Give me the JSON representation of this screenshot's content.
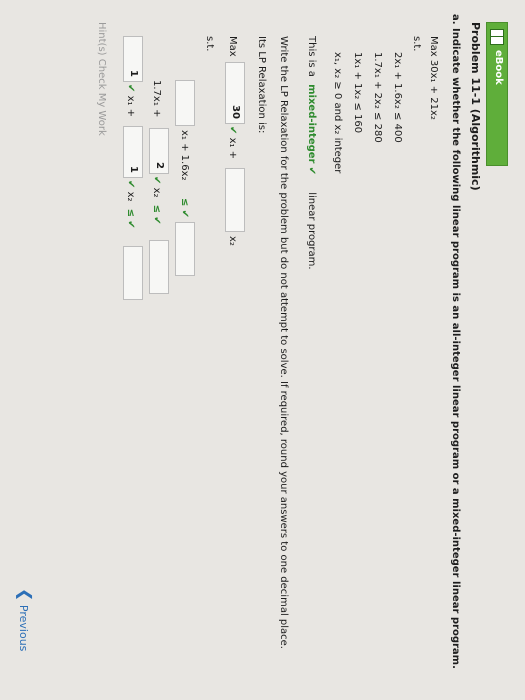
{
  "ebook": {
    "label": "eBook"
  },
  "problem": {
    "title": "Problem 11-1 (Algorithmic)"
  },
  "part_a": {
    "prompt": "a. Indicate whether the following linear program is an all-integer linear program or a mixed-integer linear program.",
    "objective": "Max 30x₁ + 21x₂",
    "st": "s.t.",
    "constraints": [
      "2x₁ + 1.6x₂ ≤ 400",
      "1.7x₁ + 2x₂ ≤ 280",
      "1x₁ + 1x₂ ≤ 160",
      "x₁, x₂ ≥ 0 and x₂ integer"
    ],
    "answer_prefix": "This is a",
    "answer_value": "mixed-integer",
    "check": "✔",
    "answer_suffix": "linear program."
  },
  "relaxation": {
    "instruction": "Write the LP Relaxation for the problem but do not attempt to solve. If required, round your answers to one decimal place.",
    "label": "Its LP Relaxation is:",
    "max_label": "Max",
    "obj_coef1": "30",
    "x1_plus": "x₁ +",
    "x2": "x₂",
    "st": "s.t.",
    "row1_term": "x₁ + 1.6x₂",
    "row1_ineq": "≤",
    "row2_coef1": "1.7x₁ +",
    "row2_coef2": "2",
    "row2_ineq": "≤",
    "row3_coef1": "1",
    "row3_ineq": "≤"
  },
  "nav": {
    "previous": "Previous"
  },
  "footer_hint": "Hint(s)  Check My Work"
}
